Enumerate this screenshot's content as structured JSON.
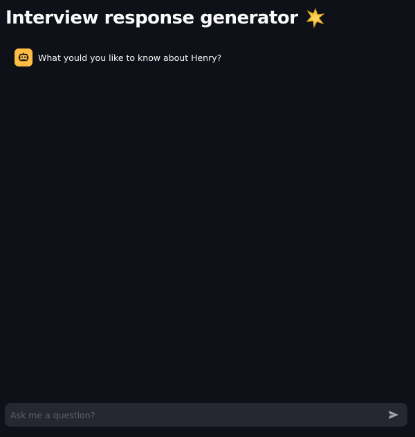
{
  "header": {
    "title": "Interview response generator",
    "emoji_icon": "sparkle-icon"
  },
  "messages": [
    {
      "role": "assistant",
      "avatar_icon": "robot-icon",
      "text": "What yould you like to know about Henry?"
    }
  ],
  "chat_input": {
    "placeholder": "Ask me a question?",
    "value": "",
    "send_icon": "send-icon"
  },
  "colors": {
    "background": "#0e1117",
    "avatar": "#ffbd45",
    "input_background": "#262730",
    "text": "#fafafa"
  }
}
